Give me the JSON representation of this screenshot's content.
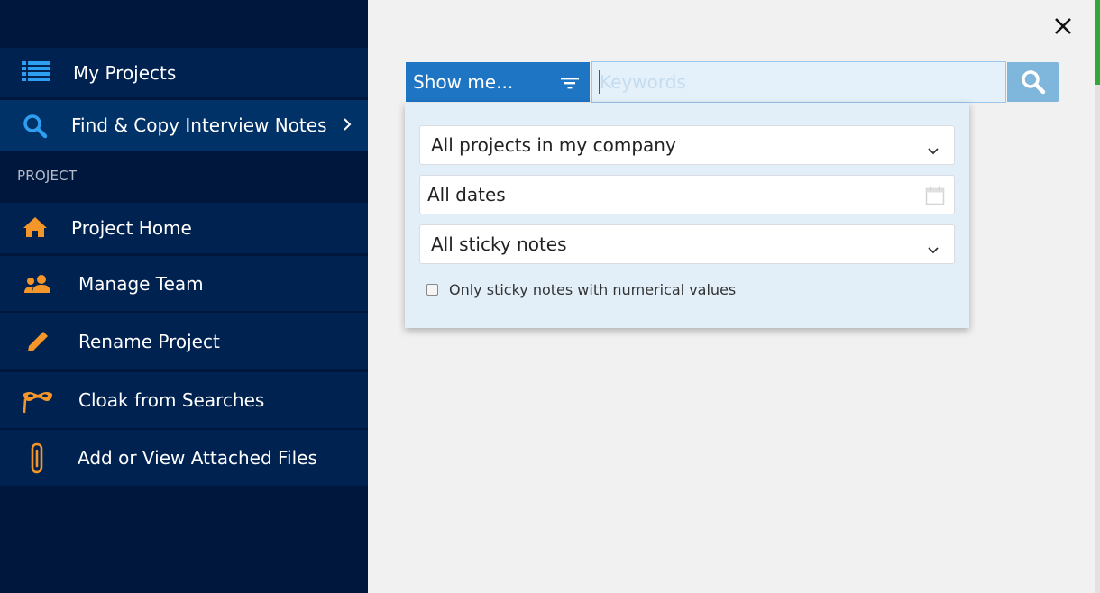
{
  "sidebar": {
    "items": [
      {
        "label": "My Projects",
        "icon": "list-icon"
      },
      {
        "label": "Find & Copy Interview Notes",
        "icon": "search-icon"
      }
    ],
    "section_label": "PROJECT",
    "project_items": [
      {
        "label": "Project Home",
        "icon": "home-icon"
      },
      {
        "label": "Manage Team",
        "icon": "team-icon"
      },
      {
        "label": "Rename Project",
        "icon": "pencil-icon"
      },
      {
        "label": "Cloak from Searches",
        "icon": "mask-icon"
      },
      {
        "label": "Add or View Attached Files",
        "icon": "paperclip-icon"
      }
    ]
  },
  "search": {
    "show_me_label": "Show me...",
    "keywords_placeholder": "Keywords",
    "keywords_value": ""
  },
  "filters": {
    "projects_selected": "All projects in my company",
    "dates_selected": "All dates",
    "notes_selected": "All sticky notes",
    "numeric_only_label": "Only sticky notes with numerical values",
    "numeric_only_checked": false
  },
  "colors": {
    "sidebar_bg": "#00173d",
    "sidebar_item": "#002251",
    "sidebar_active": "#003167",
    "accent_blue": "#1d75c3",
    "icon_orange": "#f5962a",
    "icon_blue": "#2c9ff2"
  }
}
